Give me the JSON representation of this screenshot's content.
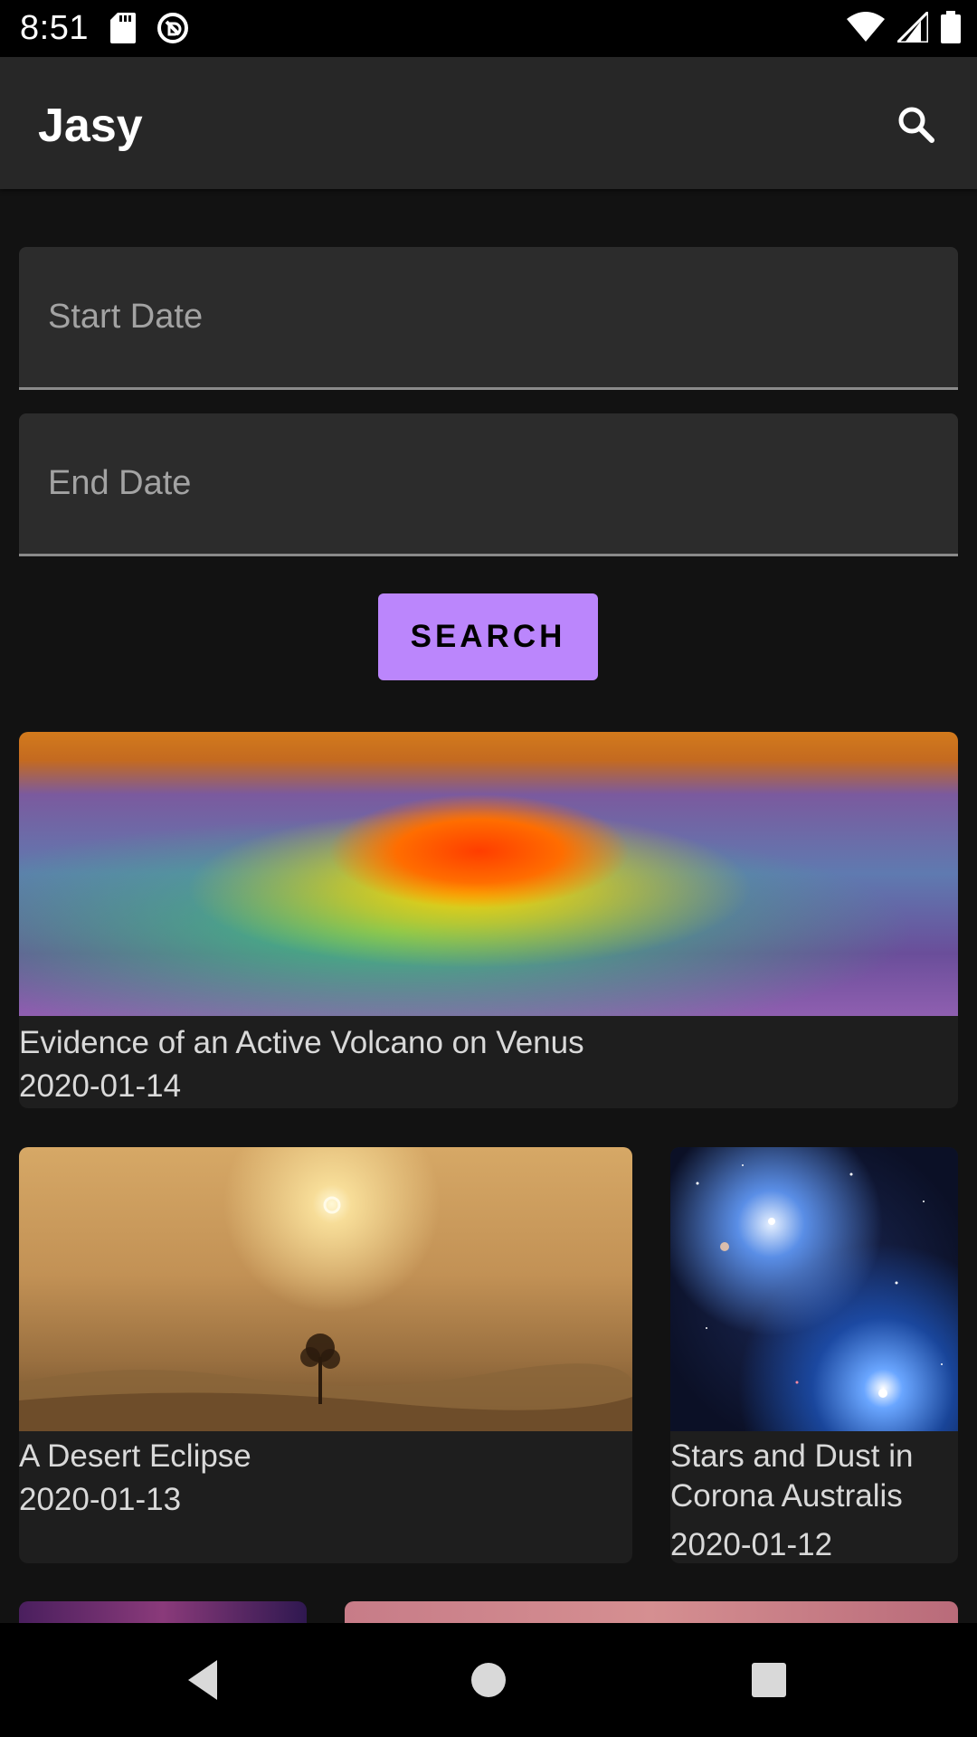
{
  "status_bar": {
    "time": "8:51",
    "left_icons": [
      "sd-card-icon",
      "dnd-icon"
    ],
    "right_icons": [
      "wifi-icon",
      "signal-icon",
      "battery-icon"
    ]
  },
  "app_bar": {
    "title": "Jasy",
    "action_icon": "search-icon"
  },
  "form": {
    "start_date": {
      "placeholder": "Start Date",
      "value": ""
    },
    "end_date": {
      "placeholder": "End Date",
      "value": ""
    },
    "search_label": "SEARCH"
  },
  "cards": [
    {
      "title": "Evidence of an Active Volcano on Venus",
      "date": "2020-01-14"
    },
    {
      "title": "A Desert Eclipse",
      "date": "2020-01-13"
    },
    {
      "title": "Stars and Dust in Corona Australis",
      "date": "2020-01-12"
    }
  ],
  "nav_bar": {
    "buttons": [
      "back-icon",
      "home-icon",
      "recents-icon"
    ]
  },
  "colors": {
    "accent": "#bb86fc",
    "background": "#121212",
    "app_bar": "#272727",
    "card": "#1e1e1e"
  }
}
